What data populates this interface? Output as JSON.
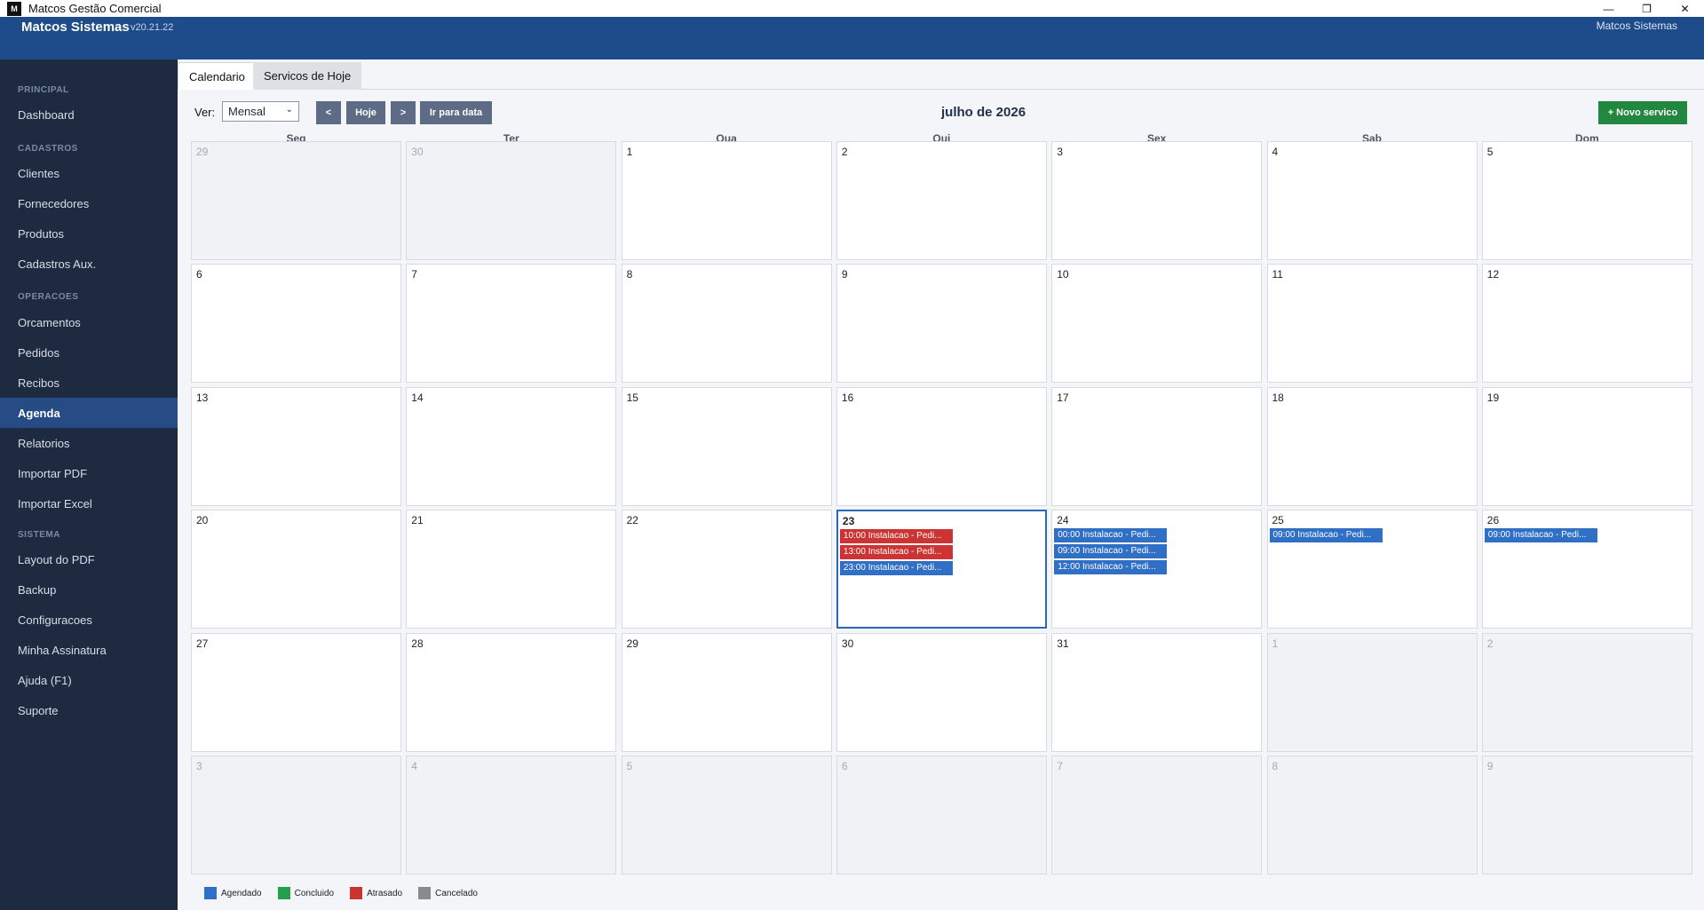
{
  "window": {
    "app_icon": "M",
    "title": "Matcos Gestão Comercial",
    "minimize_icon": "minimize-icon",
    "restore_icon": "restore-icon",
    "close_icon": "close-icon"
  },
  "header": {
    "brand": "Matcos Sistemas",
    "version": "v20.21.22",
    "user": "Matcos Sistemas"
  },
  "sidebar": {
    "sections": [
      {
        "title": "PRINCIPAL",
        "items": [
          "Dashboard"
        ]
      },
      {
        "title": "CADASTROS",
        "items": [
          "Clientes",
          "Fornecedores",
          "Produtos",
          "Cadastros Aux."
        ]
      },
      {
        "title": "OPERACOES",
        "items": [
          "Orcamentos",
          "Pedidos",
          "Recibos",
          "Agenda",
          "Relatorios",
          "Importar PDF",
          "Importar Excel"
        ]
      },
      {
        "title": "SISTEMA",
        "items": [
          "Layout do PDF",
          "Backup",
          "Configuracoes",
          "Minha Assinatura",
          "Ajuda (F1)",
          "Suporte"
        ]
      }
    ],
    "active_item": "Agenda"
  },
  "tabs": [
    "Calendario",
    "Servicos de Hoje"
  ],
  "active_tab": "Calendario",
  "toolbar": {
    "view_label": "Ver:",
    "view_value": "Mensal",
    "prev_label": "<",
    "today_label": "Hoje",
    "next_label": ">",
    "goto_label": "Ir para data",
    "month_title": "julho de 2026",
    "new_label": "+ Novo servico"
  },
  "calendar": {
    "weekdays": [
      "Seg",
      "Ter",
      "Qua",
      "Qui",
      "Sex",
      "Sab",
      "Dom"
    ],
    "today": "23",
    "weeks": [
      [
        {
          "day": "29",
          "outside": true
        },
        {
          "day": "30",
          "outside": true
        },
        {
          "day": "1"
        },
        {
          "day": "2"
        },
        {
          "day": "3"
        },
        {
          "day": "4"
        },
        {
          "day": "5"
        }
      ],
      [
        {
          "day": "6"
        },
        {
          "day": "7"
        },
        {
          "day": "8"
        },
        {
          "day": "9"
        },
        {
          "day": "10"
        },
        {
          "day": "11"
        },
        {
          "day": "12"
        }
      ],
      [
        {
          "day": "13"
        },
        {
          "day": "14"
        },
        {
          "day": "15"
        },
        {
          "day": "16"
        },
        {
          "day": "17"
        },
        {
          "day": "18"
        },
        {
          "day": "19"
        }
      ],
      [
        {
          "day": "20"
        },
        {
          "day": "21"
        },
        {
          "day": "22"
        },
        {
          "day": "23",
          "today": true,
          "events": [
            {
              "text": "10:00 Instalacao - Pedi...",
              "status": "atrasado"
            },
            {
              "text": "13:00 Instalacao - Pedi...",
              "status": "atrasado"
            },
            {
              "text": "23:00 Instalacao - Pedi...",
              "status": "agendado"
            }
          ]
        },
        {
          "day": "24",
          "events": [
            {
              "text": "00:00 Instalacao - Pedi...",
              "status": "agendado"
            },
            {
              "text": "09:00 Instalacao - Pedi...",
              "status": "agendado"
            },
            {
              "text": "12:00 Instalacao - Pedi...",
              "status": "agendado"
            }
          ]
        },
        {
          "day": "25",
          "events": [
            {
              "text": "09:00 Instalacao - Pedi...",
              "status": "agendado"
            }
          ]
        },
        {
          "day": "26",
          "events": [
            {
              "text": "09:00 Instalacao - Pedi...",
              "status": "agendado"
            }
          ]
        }
      ],
      [
        {
          "day": "27"
        },
        {
          "day": "28"
        },
        {
          "day": "29"
        },
        {
          "day": "30"
        },
        {
          "day": "31"
        },
        {
          "day": "1",
          "outside": true
        },
        {
          "day": "2",
          "outside": true
        }
      ],
      [
        {
          "day": "3",
          "outside": true
        },
        {
          "day": "4",
          "outside": true
        },
        {
          "day": "5",
          "outside": true
        },
        {
          "day": "6",
          "outside": true
        },
        {
          "day": "7",
          "outside": true
        },
        {
          "day": "8",
          "outside": true
        },
        {
          "day": "9",
          "outside": true
        }
      ]
    ]
  },
  "legend": [
    {
      "label": "Agendado",
      "status": "agendado"
    },
    {
      "label": "Concluido",
      "status": "concluido"
    },
    {
      "label": "Atrasado",
      "status": "atrasado"
    },
    {
      "label": "Cancelado",
      "status": "cancelado"
    }
  ],
  "colors": {
    "agendado": "#2f6fc6",
    "concluido": "#22a04b",
    "atrasado": "#cc3333",
    "cancelado": "#8a8a8a",
    "header": "#1e4b8a",
    "sidebar": "#1e2a40",
    "sidebar_active": "#264b85",
    "new_button": "#22883f"
  }
}
